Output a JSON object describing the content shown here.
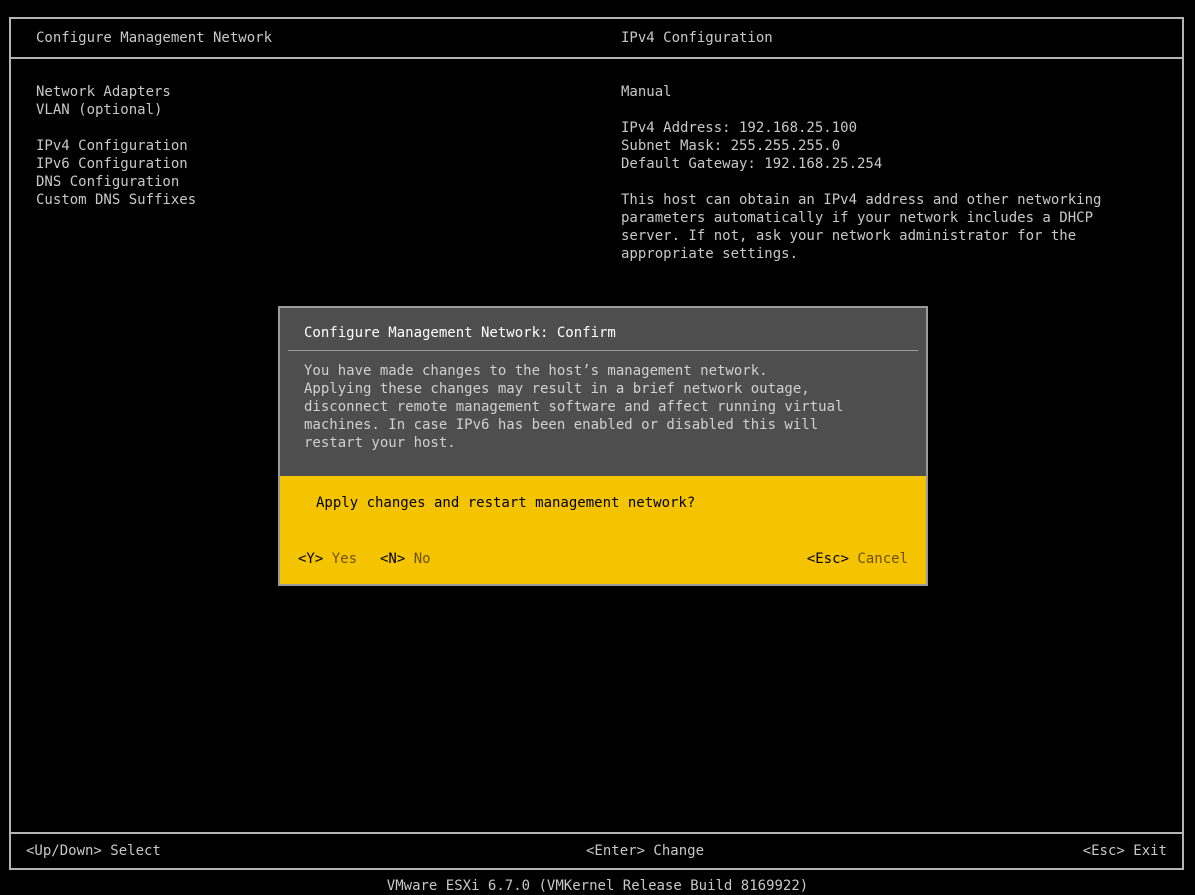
{
  "header": {
    "left_title": "Configure Management Network",
    "right_title": "IPv4 Configuration"
  },
  "menu": {
    "items": [
      "Network Adapters",
      "VLAN (optional)",
      "",
      "IPv4 Configuration",
      "IPv6 Configuration",
      "DNS Configuration",
      "Custom DNS Suffixes"
    ]
  },
  "detail": {
    "mode": "Manual",
    "ipv4_address": "IPv4 Address: 192.168.25.100",
    "subnet_mask": "Subnet Mask: 255.255.255.0",
    "default_gateway": "Default Gateway: 192.168.25.254",
    "help_lines": [
      "This host can obtain an IPv4 address and other networking",
      "parameters automatically if your network includes a DHCP",
      "server. If not, ask your network administrator for the",
      "appropriate settings."
    ]
  },
  "dialog": {
    "title": "Configure Management Network: Confirm",
    "body_lines": [
      "You have made changes to the host’s management network.",
      "Applying these changes may result in a brief network outage,",
      "disconnect remote management software and affect running virtual",
      "machines. In case IPv6 has been enabled or disabled this will",
      "restart your host."
    ],
    "question": "Apply changes and restart management network?",
    "yes_key": "<Y>",
    "yes_label": "Yes",
    "no_key": "<N>",
    "no_label": "No",
    "cancel_key": "<Esc>",
    "cancel_label": "Cancel"
  },
  "footer": {
    "left": "<Up/Down> Select",
    "middle": "<Enter> Change",
    "right": "<Esc> Exit"
  },
  "version": "VMware ESXi 6.7.0 (VMKernel Release Build 8169922)"
}
